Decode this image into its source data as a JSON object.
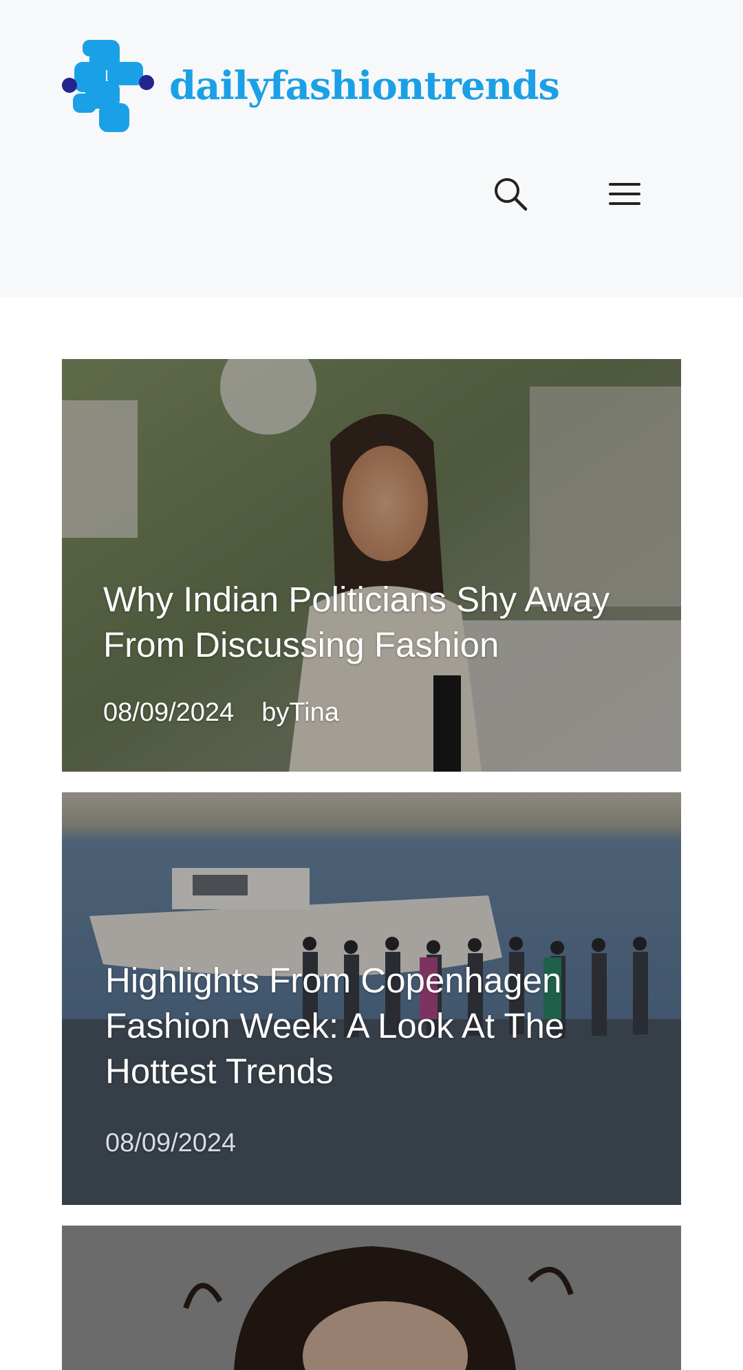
{
  "header": {
    "logo_text": "dailyfashiontrends",
    "colors": {
      "logo_primary": "#1aa0e6",
      "logo_secondary": "#23248f",
      "background": "#f7f8f9"
    },
    "icons": {
      "search": "search-icon",
      "menu": "hamburger-menu-icon"
    }
  },
  "posts": [
    {
      "title": "Why Indian Politicians Shy Away From Discussing Fashion",
      "date": "08/09/2024",
      "author": "byTina",
      "image": "woman-smiling-street-photo"
    },
    {
      "title": "Highlights From Copenhagen Fashion Week: A Look At The Hottest Trends",
      "date": "08/09/2024",
      "image": "cyclists-harbor-boats-photo"
    },
    {
      "image": "curly-hair-portrait-photo"
    }
  ]
}
